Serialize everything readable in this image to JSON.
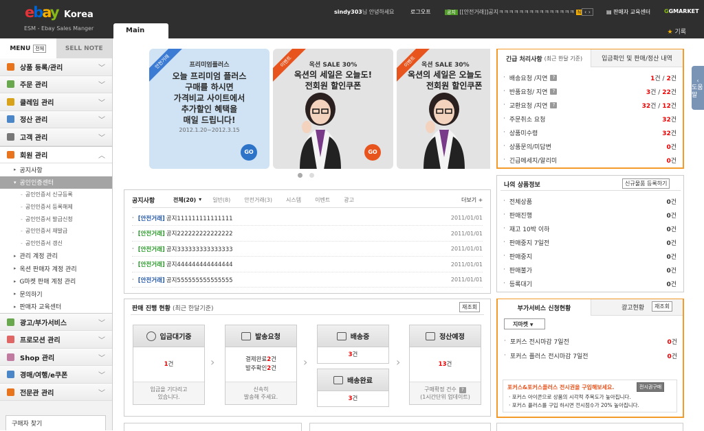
{
  "header": {
    "logo_letters": [
      "e",
      "b",
      "a",
      "y"
    ],
    "logo_korea": "Korea",
    "subtitle": "ESM - Ebay Sales Manger",
    "user": "sindy303",
    "greeting": "님 안녕하세요",
    "logout": "로그오프",
    "notice_badge": "공지",
    "notice_text": "[[안전거래]]공지ㅋㅋㅋㅋㅋㅋㅋㅋㅋㅋㅋㅋㅋㅋㅋ",
    "new_badge": "N",
    "edu": "판매자 교육센터",
    "gmarket": "GMARKET",
    "main_tab": "Main",
    "favorite": "기록"
  },
  "sidebar": {
    "tab_menu": "MENU",
    "tab_all": "전체",
    "tab_sellnote": "SELL NOTE",
    "menus_top": [
      {
        "label": "상품 등록/관리",
        "color": "#e8741e"
      },
      {
        "label": "주문 관리",
        "color": "#6aa84f"
      },
      {
        "label": "클레임 관리",
        "color": "#d9a21b"
      },
      {
        "label": "정산 관리",
        "color": "#4a86c8"
      },
      {
        "label": "고객 관리",
        "color": "#777777"
      }
    ],
    "member": {
      "label": "회원 관리",
      "color": "#e8741e"
    },
    "subs1": [
      "공지사항"
    ],
    "sel_sub": "공인인증센터",
    "subsubs": [
      "공인인증서 신규등록",
      "공인인증서 등록해제",
      "공인인증서 발급신청",
      "공인인증서 재발급",
      "공인인증서 갱신"
    ],
    "subs2": [
      "관리 계정 관리",
      "옥션 판매자 계정 관리",
      "G마켓 판매 계정 관리",
      "문의하기",
      "판매자 교육센터"
    ],
    "menus_bottom": [
      {
        "label": "광고/부가서비스",
        "color": "#6aa84f"
      },
      {
        "label": "프로모션 관리",
        "color": "#e06666"
      },
      {
        "label": "Shop 관리",
        "color": "#c27ba0"
      },
      {
        "label": "경매/여행/e쿠폰",
        "color": "#4a86c8"
      },
      {
        "label": "전문관 관리",
        "color": "#e8741e"
      }
    ],
    "buyer": "구매자 찾기"
  },
  "banners": [
    {
      "rib": "안전거래",
      "t1": "프리미엄플러스",
      "t2a": "오늘 프리미엄 플러스",
      "t2b": "구매를 하시면",
      "t2c": "가격비교 사이트에서",
      "t2d": "추가할인 혜택을",
      "t2e": "매일 드립니다!",
      "t3": "2012.1.20~2012.3.15",
      "go": "GO"
    },
    {
      "rib": "이벤트",
      "t1": "옥션 SALE 30%",
      "t2a": "옥션의 세일은 오늘도!",
      "t2b": "전회원 할인쿠폰",
      "go": "GO"
    },
    {
      "rib": "이벤트",
      "t1": "옥션 SALE 30%",
      "t2a": "옥션의 세일은 오늘도",
      "t2b": "전회원 할인쿠폰"
    }
  ],
  "notice": {
    "title": "공지사항",
    "tabs": [
      "전체(20)",
      "일반(8)",
      "안전거래(3)",
      "시스템",
      "이벤트",
      "광고"
    ],
    "more": "더보기 +",
    "rows": [
      {
        "tag": "[안전거래]",
        "text": "공지111111111111111",
        "date": "2011/01/01",
        "green": false
      },
      {
        "tag": "[안전거래]",
        "text": "공지222222222222222",
        "date": "2011/01/01",
        "green": true
      },
      {
        "tag": "[안전거래]",
        "text": "공지333333333333333",
        "date": "2011/01/01",
        "green": true
      },
      {
        "tag": "[안전거래]",
        "text": "공지444444444444444",
        "date": "2011/01/01",
        "green": true
      },
      {
        "tag": "[안전거래]",
        "text": "공지555555555555555",
        "date": "2011/01/01",
        "green": false
      }
    ]
  },
  "progress": {
    "title": "판매 진행 현황",
    "sub": "(최근 한달기준)",
    "refresh": "재조회",
    "wait": {
      "label": "입금대기중",
      "count": "1",
      "unit": "건",
      "foot1": "입금을 기다리고",
      "foot2": "있습니다."
    },
    "ship_req": {
      "label": "발송요청",
      "l1": "결제완료",
      "n1": "2",
      "l2": "발주확인",
      "n2": "2",
      "unit": "건",
      "foot1": "신속히",
      "foot2": "발송해 주세요."
    },
    "shipping": {
      "label": "배송중",
      "count": "3",
      "unit": "건"
    },
    "delivered": {
      "label": "배송완료",
      "count": "3",
      "unit": "건"
    },
    "settle": {
      "label": "정산예정",
      "count": "13",
      "unit": "건",
      "foot1": "구매확정 건수",
      "foot2": "(1시간단위 업데이트)"
    }
  },
  "urgent": {
    "tab1": "긴급 처리사항",
    "tab1_sub": "(최근 한달 기준)",
    "tab2": "입금확인 및 판매/정산 내역",
    "rows": [
      {
        "label": "배송요청 /지연",
        "q": true,
        "a": "1",
        "b": "2"
      },
      {
        "label": "반품요청/ 지연",
        "q": true,
        "a": "3",
        "b": "22"
      },
      {
        "label": "교환요청 /지연",
        "q": true,
        "a": "32",
        "b": "12"
      },
      {
        "label": "주문취소 요청",
        "q": false,
        "a": "32"
      },
      {
        "label": "상품미수령",
        "q": false,
        "a": "32"
      },
      {
        "label": "상품문의/미답변",
        "q": false,
        "a": "0"
      },
      {
        "label": "긴급메세지/알리미",
        "q": false,
        "a": "0"
      }
    ],
    "unit": "건"
  },
  "myinfo": {
    "title": "나의 상품정보",
    "btn": "신규물품 등록하기",
    "rows": [
      {
        "label": "전체상품",
        "v": "0"
      },
      {
        "label": "판매진행",
        "v": "0"
      },
      {
        "label": "재고 10박 이하",
        "v": "0"
      },
      {
        "label": "판매중지 7일전",
        "v": "0"
      },
      {
        "label": "판매중지",
        "v": "0"
      },
      {
        "label": "판매불가",
        "v": "0"
      },
      {
        "label": "등록대기",
        "v": "0"
      }
    ],
    "unit": "건"
  },
  "addon": {
    "tab1": "부가서비스 신청현황",
    "tab2": "광고현황",
    "refresh": "재조회",
    "select": "지마켓",
    "rows": [
      {
        "label": "포커스 전시마감 7일전",
        "v": "0"
      },
      {
        "label": "포커스 플러스 전시마감 7일전",
        "v": "0"
      }
    ],
    "unit": "건",
    "promo_title": "포커스&포커스플러스 전시권을 구입해보세요.",
    "promo_btn": "전시권구매",
    "promo1": "· 포커스 아이콘으로 상품의 시각적 주목도가 높아집니다.",
    "promo2": "· 포커스 플러스를 구입 하시면 전시점수가 20% 높아집니다."
  },
  "helper": "도움말"
}
